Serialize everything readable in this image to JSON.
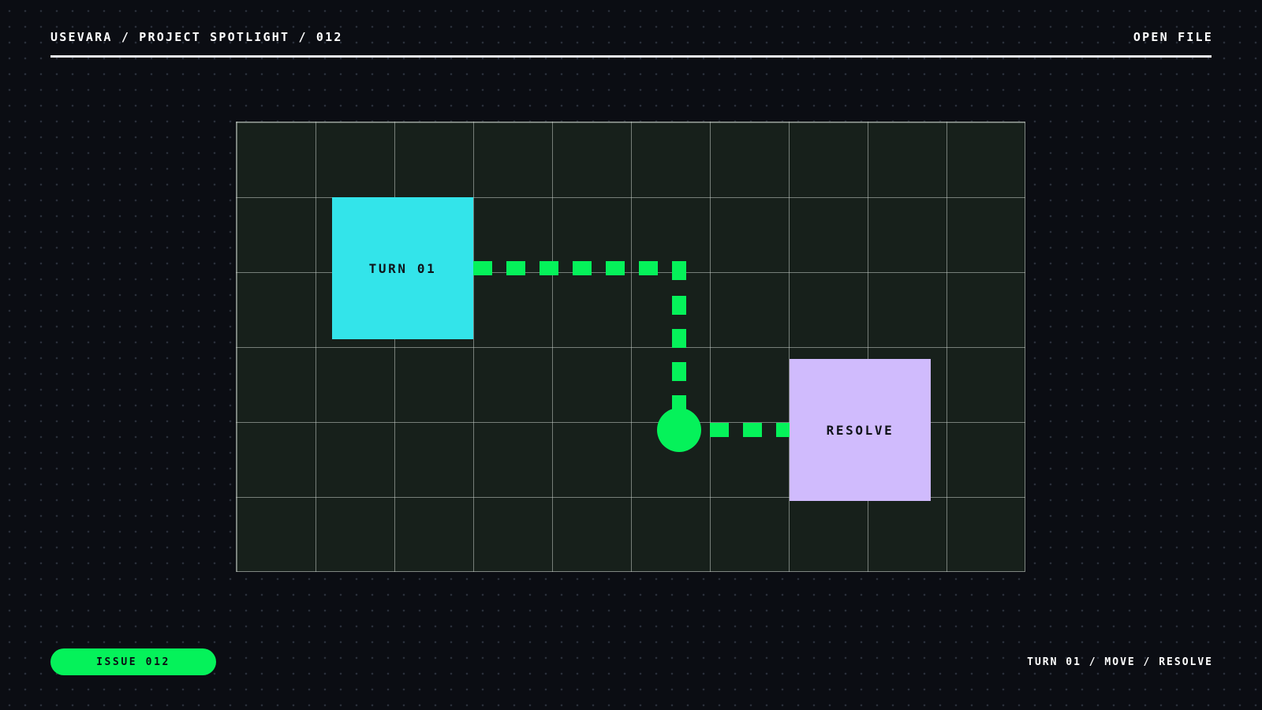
{
  "header": {
    "breadcrumb": "USEVARA / PROJECT SPOTLIGHT / 012",
    "action_label": "OPEN FILE"
  },
  "board": {
    "start_tile": {
      "label": "TURN 01",
      "color": "#33e4ea"
    },
    "end_tile": {
      "label": "RESOLVE",
      "color": "#d0bbfd"
    },
    "path_color": "#05f25a",
    "grid_columns": 10,
    "grid_rows": 6
  },
  "footer": {
    "issue_badge": "ISSUE 012",
    "sequence": "TURN 01 / MOVE / RESOLVE"
  },
  "colors": {
    "background": "#0b0d13",
    "board_fill": "#17201b",
    "accent": "#05f25a"
  }
}
